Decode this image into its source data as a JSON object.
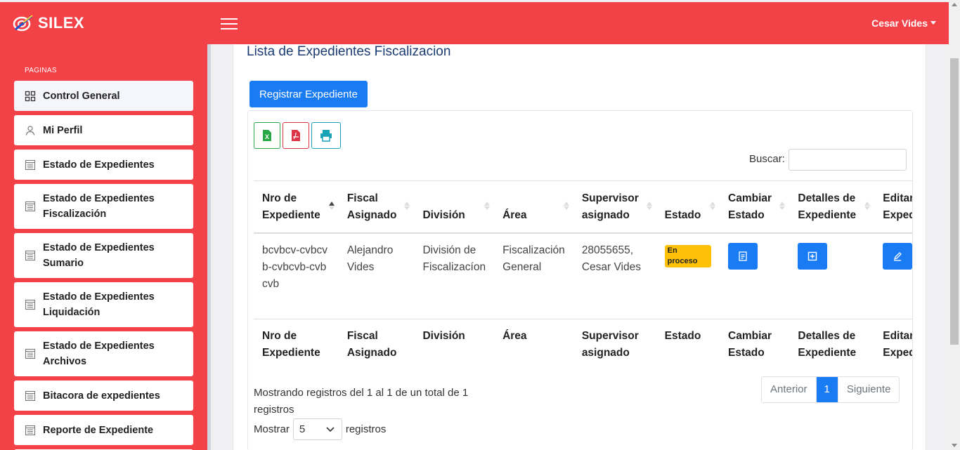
{
  "app": {
    "brand": "SILEX"
  },
  "header": {
    "user_name": "Cesar Vides"
  },
  "sidebar": {
    "heading": "PAGINAS",
    "items": [
      {
        "label": "Control General",
        "icon": "grid-icon"
      },
      {
        "label": "Mi Perfil",
        "icon": "user-icon"
      },
      {
        "label": "Estado de Expedientes",
        "icon": "document-icon"
      },
      {
        "label": "Estado de Expedientes Fiscalización",
        "icon": "document-icon"
      },
      {
        "label": "Estado de Expedientes Sumario",
        "icon": "document-icon"
      },
      {
        "label": "Estado de Expedientes Liquidación",
        "icon": "document-icon"
      },
      {
        "label": "Estado de Expedientes Archivos",
        "icon": "document-icon"
      },
      {
        "label": "Bitacora de expedientes",
        "icon": "document-icon"
      },
      {
        "label": "Reporte de Expediente",
        "icon": "document-icon"
      }
    ]
  },
  "main": {
    "title": "Lista de Expedientes Fiscalizacion",
    "register_button": "Registrar Expediente",
    "export_buttons": [
      "excel-icon",
      "pdf-icon",
      "print-icon"
    ],
    "search_label": "Buscar:",
    "search_value": "",
    "table": {
      "headers": [
        "Nro de Expediente",
        "Fiscal Asignado",
        "División",
        "Área",
        "Supervisor asignado",
        "Estado",
        "Cambiar Estado",
        "Detalles de Expediente",
        "Editar Expediente"
      ],
      "rows": [
        {
          "nro": "bcvbcv-cvbcvb-cvbcvb-cvbcvb",
          "fiscal": "Alejandro Vides",
          "division": "División de Fiscalizacíon",
          "area": "Fiscalización General",
          "supervisor": "28055655, Cesar Vides",
          "estado": "En proceso"
        }
      ]
    },
    "info": "Mostrando registros del 1 al 1 de un total de 1 registros",
    "length_prefix": "Mostrar",
    "length_value": "5",
    "length_suffix": "registros",
    "pager": {
      "prev": "Anterior",
      "current": "1",
      "next": "Siguiente"
    }
  },
  "colors": {
    "brand_red": "#f24147",
    "primary_blue": "#1a7cf5",
    "badge_yellow": "#ffc107",
    "title_navy": "#1b3b73"
  }
}
